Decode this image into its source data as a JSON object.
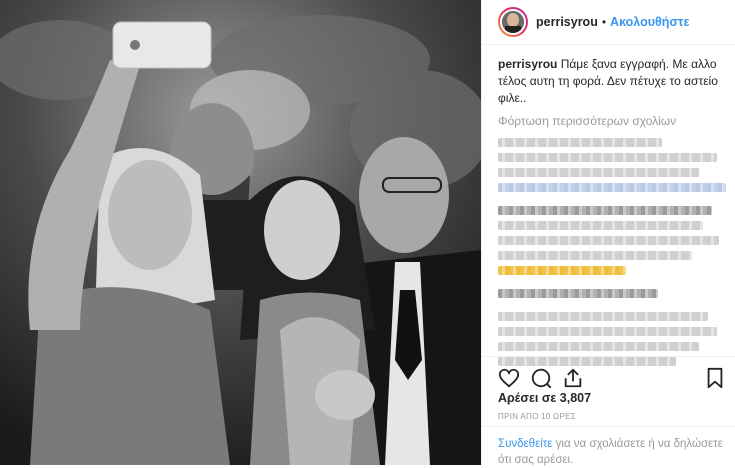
{
  "post": {
    "username": "perrisyrou",
    "separator": "•",
    "follow_label": "Ακολουθήστε",
    "caption_user": "perrisyrou",
    "caption_text": "Πάμε ξανα εγγραφή. Με αλλο τέλος αυτη τη φορά. Δεν πέτυχε το αστείο φιλε..",
    "load_more": "Φόρτωση περισσότερων σχολίων",
    "likes": "Αρέσει σε 3,807",
    "timestamp": "ΠΡΙΝ ΑΠΟ 10 ΩΡΕΣ",
    "login_link": "Συνδεθείτε",
    "login_rest": " για να σχολιάσετε ή να δηλώσετε ότι σας αρέσει."
  },
  "icons": {
    "like": "heart-icon",
    "comment": "comment-icon",
    "share": "share-icon",
    "save": "bookmark-icon"
  },
  "colors": {
    "link": "#3897f0",
    "muted": "#999999",
    "text": "#262626"
  }
}
